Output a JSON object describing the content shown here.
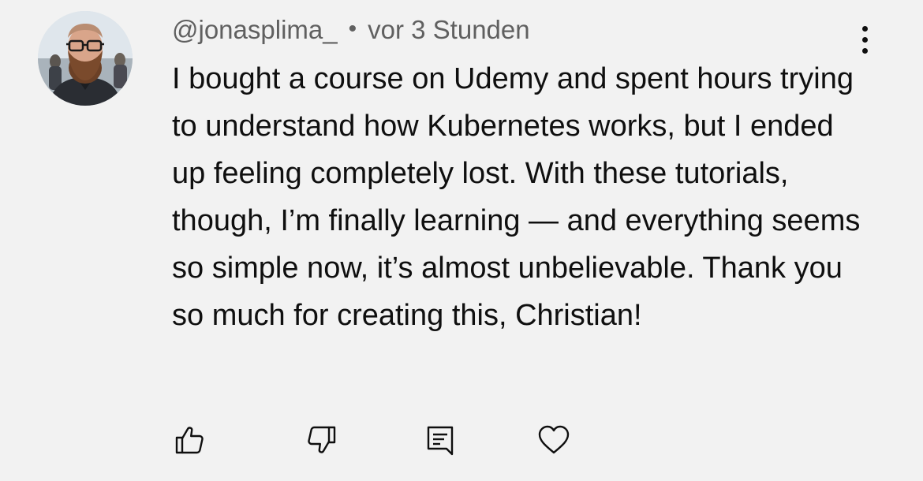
{
  "comment": {
    "author": "@jonasplima_",
    "separator": "•",
    "time": "vor 3 Stunden",
    "text": "I bought a course on Udemy and spent hours trying to understand how Kubernetes works, but I ended up feeling completely lost. With these tutorials, though, I’m finally learning — and everything seems so simple now, it’s almost unbelievable. Thank you so much for creating this, Christian!",
    "avatar_icon": "user-avatar-photo"
  },
  "actions": {
    "like_icon": "thumbs-up-icon",
    "dislike_icon": "thumbs-down-icon",
    "reply_icon": "comment-icon",
    "heart_icon": "heart-icon"
  },
  "menu_icon": "more-vertical-icon",
  "colors": {
    "background": "#f2f2f2",
    "text": "#0f0f0f",
    "meta": "#606060"
  }
}
